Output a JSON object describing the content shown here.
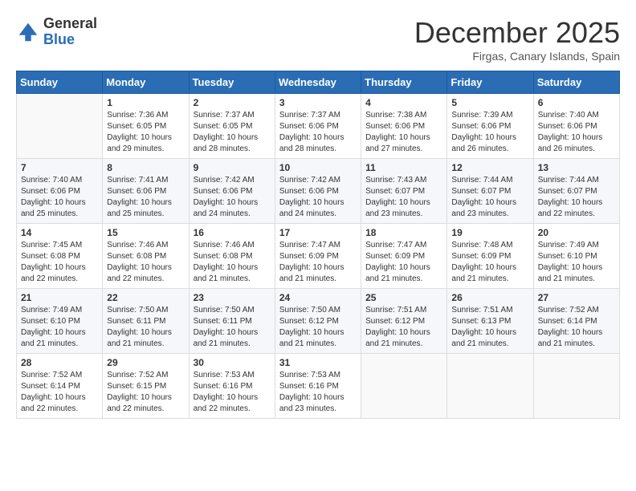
{
  "header": {
    "logo_general": "General",
    "logo_blue": "Blue",
    "month": "December 2025",
    "location": "Firgas, Canary Islands, Spain"
  },
  "weekdays": [
    "Sunday",
    "Monday",
    "Tuesday",
    "Wednesday",
    "Thursday",
    "Friday",
    "Saturday"
  ],
  "weeks": [
    [
      {
        "day": "",
        "empty": true
      },
      {
        "day": "1",
        "sunrise": "7:36 AM",
        "sunset": "6:05 PM",
        "daylight": "10 hours and 29 minutes."
      },
      {
        "day": "2",
        "sunrise": "7:37 AM",
        "sunset": "6:05 PM",
        "daylight": "10 hours and 28 minutes."
      },
      {
        "day": "3",
        "sunrise": "7:37 AM",
        "sunset": "6:06 PM",
        "daylight": "10 hours and 28 minutes."
      },
      {
        "day": "4",
        "sunrise": "7:38 AM",
        "sunset": "6:06 PM",
        "daylight": "10 hours and 27 minutes."
      },
      {
        "day": "5",
        "sunrise": "7:39 AM",
        "sunset": "6:06 PM",
        "daylight": "10 hours and 26 minutes."
      },
      {
        "day": "6",
        "sunrise": "7:40 AM",
        "sunset": "6:06 PM",
        "daylight": "10 hours and 26 minutes."
      }
    ],
    [
      {
        "day": "7",
        "sunrise": "7:40 AM",
        "sunset": "6:06 PM",
        "daylight": "10 hours and 25 minutes."
      },
      {
        "day": "8",
        "sunrise": "7:41 AM",
        "sunset": "6:06 PM",
        "daylight": "10 hours and 25 minutes."
      },
      {
        "day": "9",
        "sunrise": "7:42 AM",
        "sunset": "6:06 PM",
        "daylight": "10 hours and 24 minutes."
      },
      {
        "day": "10",
        "sunrise": "7:42 AM",
        "sunset": "6:06 PM",
        "daylight": "10 hours and 24 minutes."
      },
      {
        "day": "11",
        "sunrise": "7:43 AM",
        "sunset": "6:07 PM",
        "daylight": "10 hours and 23 minutes."
      },
      {
        "day": "12",
        "sunrise": "7:44 AM",
        "sunset": "6:07 PM",
        "daylight": "10 hours and 23 minutes."
      },
      {
        "day": "13",
        "sunrise": "7:44 AM",
        "sunset": "6:07 PM",
        "daylight": "10 hours and 22 minutes."
      }
    ],
    [
      {
        "day": "14",
        "sunrise": "7:45 AM",
        "sunset": "6:08 PM",
        "daylight": "10 hours and 22 minutes."
      },
      {
        "day": "15",
        "sunrise": "7:46 AM",
        "sunset": "6:08 PM",
        "daylight": "10 hours and 22 minutes."
      },
      {
        "day": "16",
        "sunrise": "7:46 AM",
        "sunset": "6:08 PM",
        "daylight": "10 hours and 21 minutes."
      },
      {
        "day": "17",
        "sunrise": "7:47 AM",
        "sunset": "6:09 PM",
        "daylight": "10 hours and 21 minutes."
      },
      {
        "day": "18",
        "sunrise": "7:47 AM",
        "sunset": "6:09 PM",
        "daylight": "10 hours and 21 minutes."
      },
      {
        "day": "19",
        "sunrise": "7:48 AM",
        "sunset": "6:09 PM",
        "daylight": "10 hours and 21 minutes."
      },
      {
        "day": "20",
        "sunrise": "7:49 AM",
        "sunset": "6:10 PM",
        "daylight": "10 hours and 21 minutes."
      }
    ],
    [
      {
        "day": "21",
        "sunrise": "7:49 AM",
        "sunset": "6:10 PM",
        "daylight": "10 hours and 21 minutes."
      },
      {
        "day": "22",
        "sunrise": "7:50 AM",
        "sunset": "6:11 PM",
        "daylight": "10 hours and 21 minutes."
      },
      {
        "day": "23",
        "sunrise": "7:50 AM",
        "sunset": "6:11 PM",
        "daylight": "10 hours and 21 minutes."
      },
      {
        "day": "24",
        "sunrise": "7:50 AM",
        "sunset": "6:12 PM",
        "daylight": "10 hours and 21 minutes."
      },
      {
        "day": "25",
        "sunrise": "7:51 AM",
        "sunset": "6:12 PM",
        "daylight": "10 hours and 21 minutes."
      },
      {
        "day": "26",
        "sunrise": "7:51 AM",
        "sunset": "6:13 PM",
        "daylight": "10 hours and 21 minutes."
      },
      {
        "day": "27",
        "sunrise": "7:52 AM",
        "sunset": "6:14 PM",
        "daylight": "10 hours and 21 minutes."
      }
    ],
    [
      {
        "day": "28",
        "sunrise": "7:52 AM",
        "sunset": "6:14 PM",
        "daylight": "10 hours and 22 minutes."
      },
      {
        "day": "29",
        "sunrise": "7:52 AM",
        "sunset": "6:15 PM",
        "daylight": "10 hours and 22 minutes."
      },
      {
        "day": "30",
        "sunrise": "7:53 AM",
        "sunset": "6:16 PM",
        "daylight": "10 hours and 22 minutes."
      },
      {
        "day": "31",
        "sunrise": "7:53 AM",
        "sunset": "6:16 PM",
        "daylight": "10 hours and 23 minutes."
      },
      {
        "day": "",
        "empty": true
      },
      {
        "day": "",
        "empty": true
      },
      {
        "day": "",
        "empty": true
      }
    ]
  ],
  "labels": {
    "sunrise": "Sunrise:",
    "sunset": "Sunset:",
    "daylight": "Daylight:"
  }
}
